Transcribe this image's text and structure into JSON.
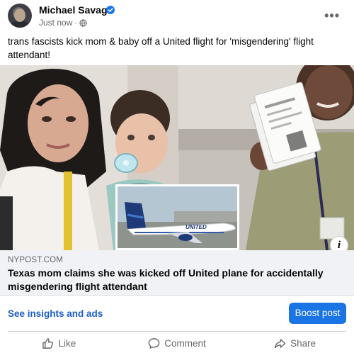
{
  "post": {
    "author": "Michael Savage",
    "timestamp": "Just now",
    "separator": "·",
    "caption": "trans fascists kick mom & baby off a United flight for 'misgendering' flight attendant!",
    "more_icon": "more-horizontal-icon"
  },
  "link_preview": {
    "domain": "NYPOST.COM",
    "headline": "Texas mom claims she was kicked off United plane for accidentally misgendering flight attendant",
    "inset_logo_text": "UNITED"
  },
  "actions_bar": {
    "insights_label": "See insights and ads",
    "boost_label": "Boost post"
  },
  "reactions": {
    "like_label": "Like",
    "comment_label": "Comment",
    "share_label": "Share"
  },
  "colors": {
    "brand_blue": "#1b74e4",
    "link_blue": "#1d5ec6",
    "muted": "#65676b"
  }
}
